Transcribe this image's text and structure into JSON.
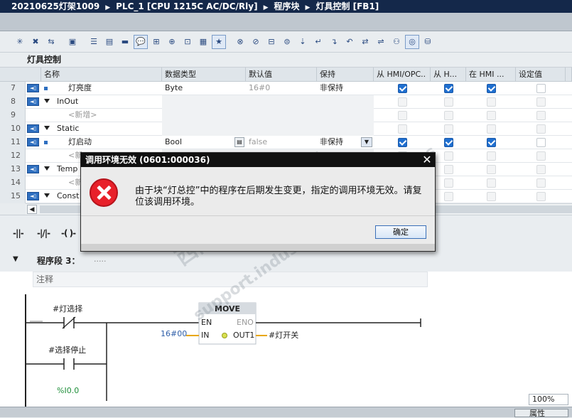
{
  "titlebar": {
    "project": "20210625灯架1009",
    "device": "PLC_1 [CPU 1215C AC/DC/Rly]",
    "folder": "程序块",
    "block": "灯具控制 [FB1]"
  },
  "block_title": "灯具控制",
  "table": {
    "headers": [
      "名称",
      "数据类型",
      "默认值",
      "保持",
      "从 HMI/OPC..",
      "从 H...",
      "在 HMI ...",
      "设定值"
    ],
    "rows": [
      {
        "num": "7",
        "name": "灯亮度",
        "type": "Byte",
        "default": "16#0",
        "retain": "非保持",
        "c1": true,
        "c2": true,
        "c3": true,
        "kind": "var"
      },
      {
        "num": "8",
        "name": "InOut",
        "type": "",
        "default": "",
        "retain": "",
        "kind": "section"
      },
      {
        "num": "9",
        "name": "<新增>",
        "type": "",
        "default": "",
        "retain": "",
        "kind": "new"
      },
      {
        "num": "10",
        "name": "Static",
        "type": "",
        "default": "",
        "retain": "",
        "kind": "section"
      },
      {
        "num": "11",
        "name": "灯启动",
        "type": "Bool",
        "default": "false",
        "retain": "非保持",
        "c1": true,
        "c2": true,
        "c3": true,
        "kind": "var"
      },
      {
        "num": "12",
        "name": "<新",
        "type": "",
        "default": "",
        "retain": "",
        "kind": "new"
      },
      {
        "num": "13",
        "name": "Temp",
        "type": "",
        "default": "",
        "retain": "",
        "kind": "section"
      },
      {
        "num": "14",
        "name": "<新",
        "type": "",
        "default": "",
        "retain": "",
        "kind": "new"
      },
      {
        "num": "15",
        "name": "Const",
        "type": "",
        "default": "",
        "retain": "",
        "kind": "section"
      }
    ]
  },
  "ladder_symbols": [
    "-||-",
    "-|/|-",
    "-( )-"
  ],
  "network": {
    "title": "程序段 3：",
    "title_dots": ".....",
    "comment": "注释",
    "contact1_tag": "#灯选择",
    "contact2_tag": "#选择停止",
    "contact3_tag": "%I0.0",
    "move_title": "MOVE",
    "en": "EN",
    "eno": "ENO",
    "in_label": "IN",
    "in_value": "16#00",
    "out_label": "OUT1",
    "out_tag": "#灯开关"
  },
  "dialog": {
    "title": "调用环境无效 (0601:000036)",
    "message": "由于块“灯总控”中的程序在后期发生变更，指定的调用环境无效。请复位该调用环境。",
    "ok_label": "确定"
  },
  "watermark": {
    "line1": "西门子工业  找答案",
    "line2": "support.industry.siemens.com/cs"
  },
  "statusbar": {
    "zoom": "100%",
    "props": "属性"
  }
}
